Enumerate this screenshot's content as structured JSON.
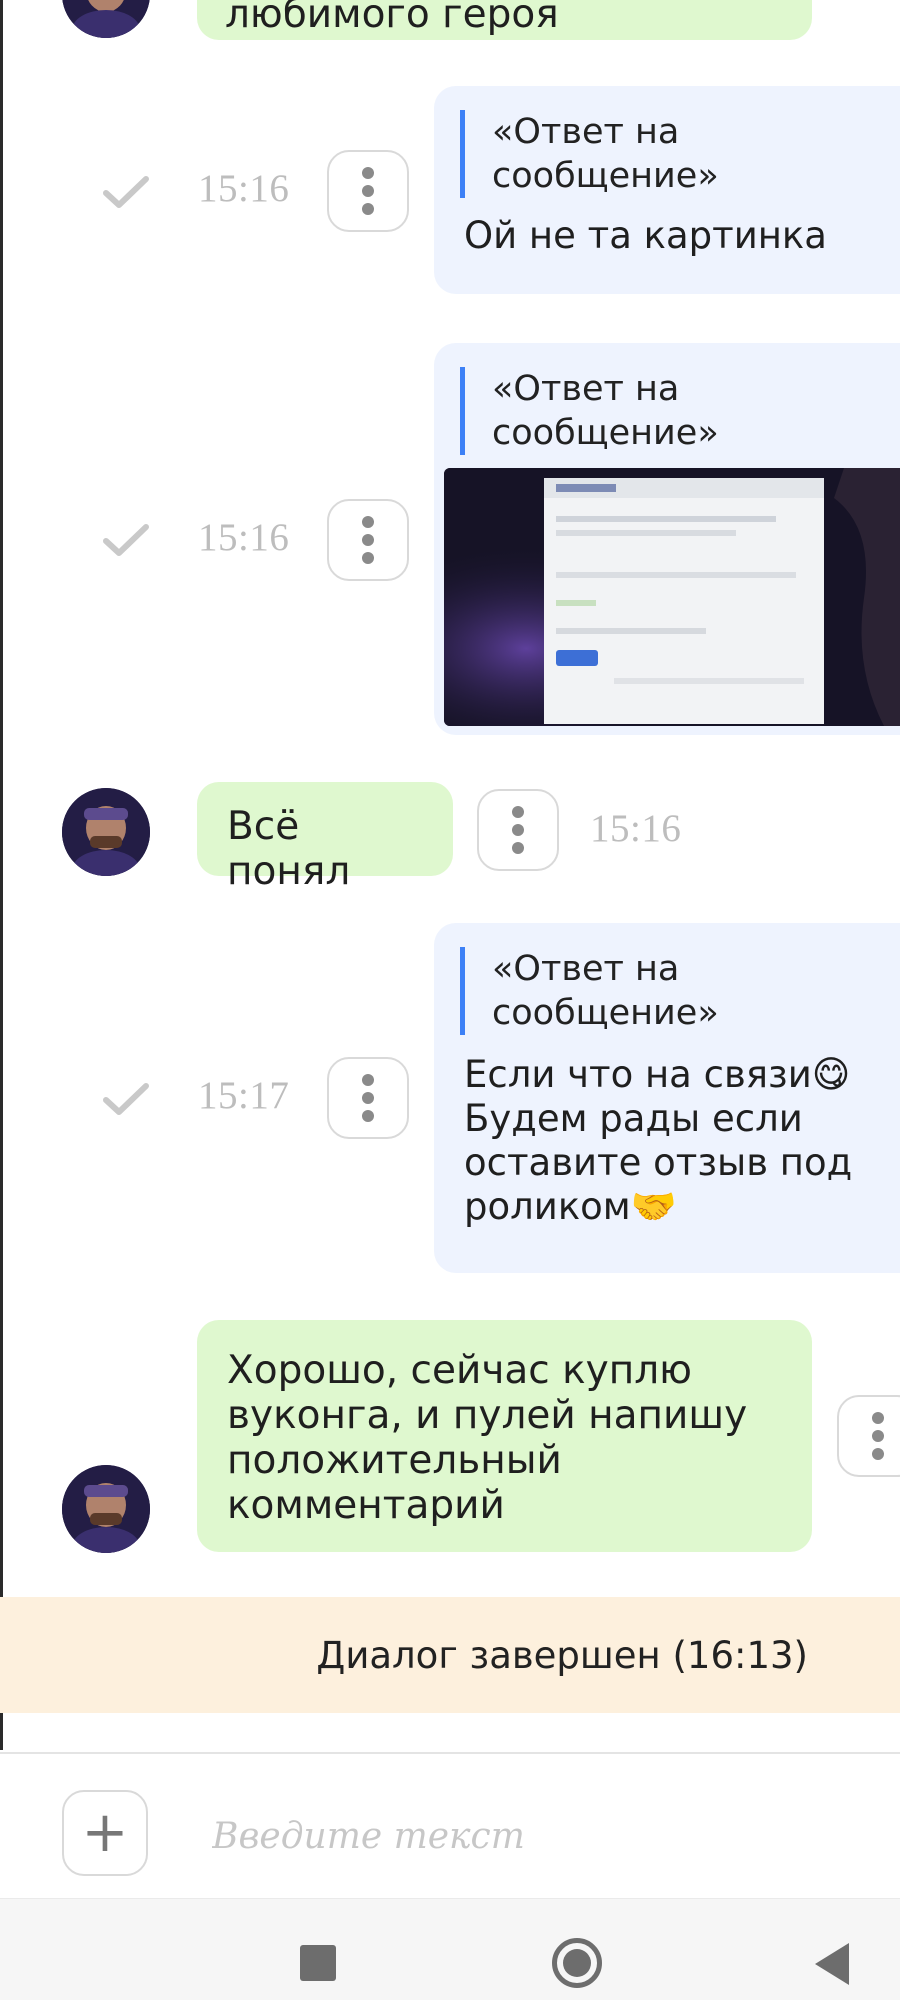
{
  "colors": {
    "incoming_bubble": "#dff8cf",
    "outgoing_bubble": "#eef3fe",
    "quote_bar": "#3d80f6",
    "banner_bg": "#fdf0dd",
    "timestamp": "#bdbdbd",
    "icon_gray": "#6d6d6d"
  },
  "messages": [
    {
      "direction": "incoming",
      "text_partial": "любимого героя"
    },
    {
      "direction": "outgoing",
      "quote": "«Ответ на\nсообщение»",
      "text": "Ой не та картинка",
      "time": "15:16",
      "status_icon": "check-icon",
      "menu_icon": "more-vertical-icon"
    },
    {
      "direction": "outgoing",
      "quote": "«Ответ на\nсообщение»",
      "attachment": "image-attachment",
      "time": "15:16",
      "status_icon": "check-icon",
      "menu_icon": "more-vertical-icon"
    },
    {
      "direction": "incoming",
      "text": "Всё понял",
      "time": "15:16",
      "menu_icon": "more-vertical-icon"
    },
    {
      "direction": "outgoing",
      "quote": "«Ответ на\nсообщение»",
      "text": "Если что на связи😋\nБудем рады если\nоставите отзыв под\nроликом🤝",
      "time": "15:17",
      "status_icon": "check-icon",
      "menu_icon": "more-vertical-icon"
    },
    {
      "direction": "incoming",
      "text": "Хорошо, сейчас куплю\nвуконга, и пулей напишу\nположительный\nкомментарий",
      "menu_icon": "more-vertical-icon"
    }
  ],
  "banner": {
    "text": "Диалог завершен (16:13)"
  },
  "composer": {
    "add_icon": "plus-icon",
    "placeholder": "Введите текст"
  },
  "navbar": {
    "icons": [
      "recents-square-icon",
      "home-circle-icon",
      "back-triangle-icon"
    ]
  }
}
